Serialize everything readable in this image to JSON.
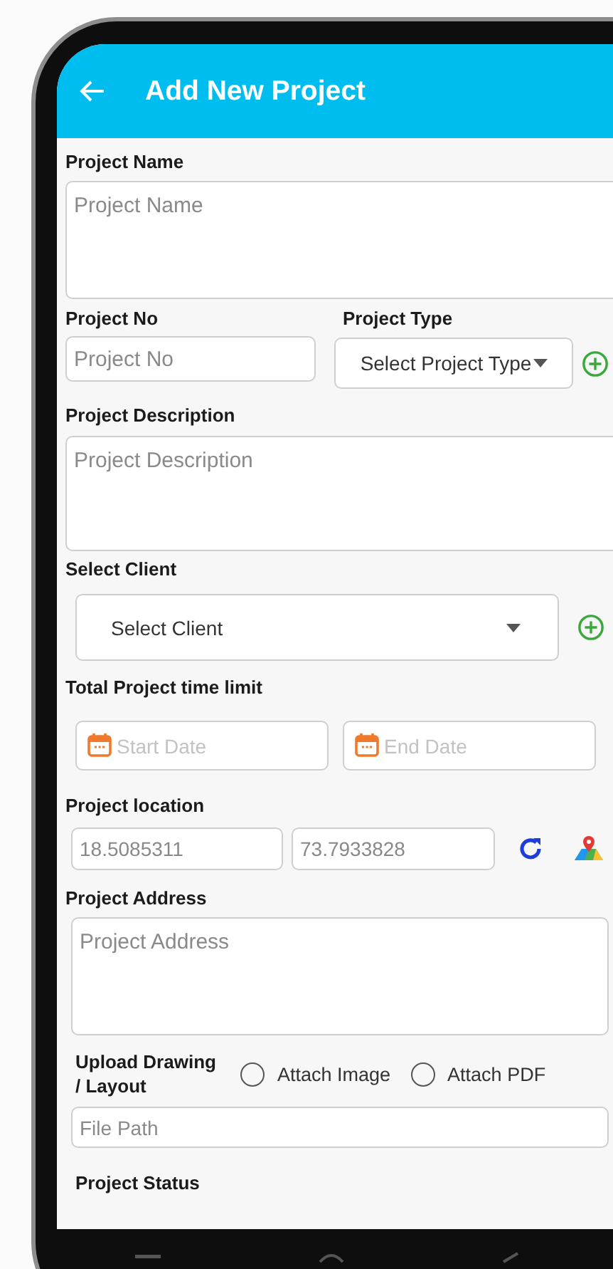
{
  "app_bar": {
    "title": "Add New Project"
  },
  "project_name": {
    "label": "Project Name",
    "placeholder": "Project Name"
  },
  "project_no": {
    "label": "Project No",
    "placeholder": "Project No"
  },
  "project_type": {
    "label": "Project Type",
    "value": "Select Project Type"
  },
  "project_description": {
    "label": "Project Description",
    "placeholder": "Project Description"
  },
  "client": {
    "label": "Select Client",
    "value": "Select Client"
  },
  "time_limit": {
    "label": "Total Project time limit",
    "start_placeholder": "Start Date",
    "end_placeholder": "End Date"
  },
  "location": {
    "label": "Project location",
    "latitude": "18.5085311",
    "longitude": "73.7933828"
  },
  "project_address": {
    "label": "Project Address",
    "placeholder": "Project Address"
  },
  "upload": {
    "label": "Upload Drawing / Layout",
    "options": [
      {
        "label": "Attach Image",
        "selected": false
      },
      {
        "label": "Attach PDF",
        "selected": false
      }
    ],
    "file_path_placeholder": "File Path"
  },
  "project_status": {
    "label": "Project Status"
  }
}
